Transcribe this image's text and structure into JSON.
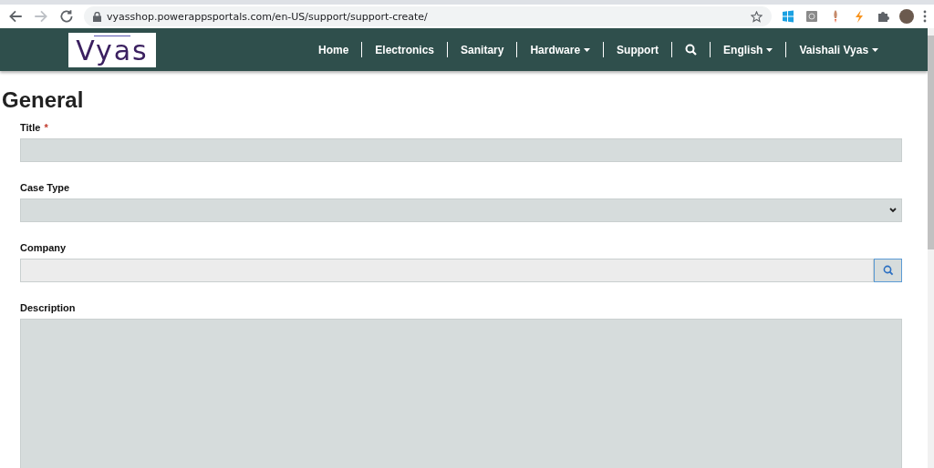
{
  "browser": {
    "url": "vyasshop.powerappsportals.com/en-US/support/support-create/"
  },
  "nav": {
    "logo": "Vyas",
    "items": [
      {
        "kind": "link",
        "label": "Home"
      },
      {
        "kind": "link",
        "label": "Electronics"
      },
      {
        "kind": "link",
        "label": "Sanitary"
      },
      {
        "kind": "dropdown",
        "label": "Hardware"
      },
      {
        "kind": "link",
        "label": "Support"
      },
      {
        "kind": "search"
      },
      {
        "kind": "dropdown",
        "label": "English"
      },
      {
        "kind": "dropdown",
        "label": "Vaishali Vyas"
      }
    ]
  },
  "form": {
    "heading": "General",
    "fields": [
      {
        "kind": "text",
        "label": "Title",
        "required_mark": "*"
      },
      {
        "kind": "select",
        "label": "Case Type"
      },
      {
        "kind": "lookup",
        "label": "Company"
      },
      {
        "kind": "textarea",
        "label": "Description"
      }
    ]
  }
}
